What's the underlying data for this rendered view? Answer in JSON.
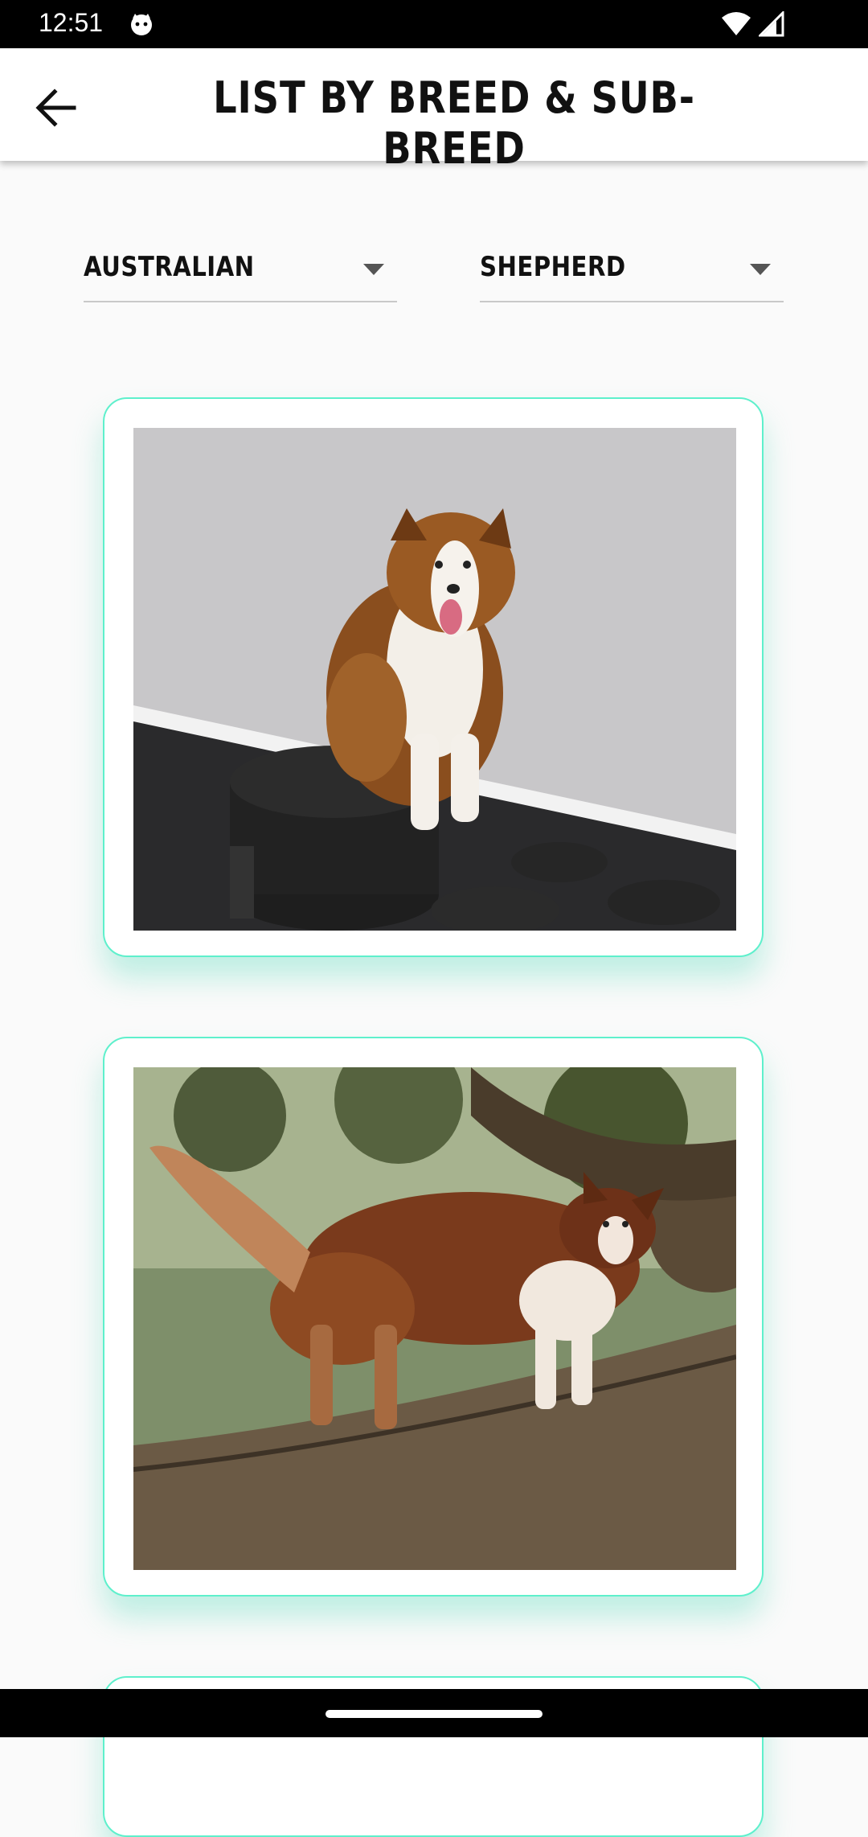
{
  "status_bar": {
    "time": "12:51"
  },
  "app_bar": {
    "title": "List by Breed & Sub-Breed",
    "back_icon": "arrow-back-icon"
  },
  "filters": {
    "breed": "Australian",
    "sub_breed": "Shepherd"
  },
  "colors": {
    "card_border": "#5ef0cc",
    "background": "#fafafa"
  }
}
